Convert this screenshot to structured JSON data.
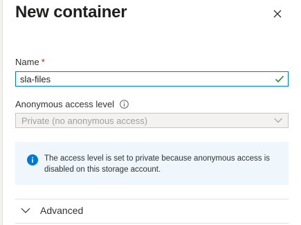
{
  "dialog": {
    "title": "New container"
  },
  "form": {
    "name_label": "Name",
    "required_marker": "*",
    "name_value": "sla-files",
    "access_label": "Anonymous access level",
    "access_selected": "Private (no anonymous access)"
  },
  "info_message": "The access level is set to private because anonymous access is disabled on this storage account.",
  "advanced": {
    "label": "Advanced"
  },
  "colors": {
    "accent": "#0078d4",
    "success": "#107c10",
    "required": "#a4262c",
    "info_bg": "#eff6fc"
  },
  "icons": [
    "close-icon",
    "checkmark-icon",
    "info-icon",
    "chevron-down-icon"
  ]
}
